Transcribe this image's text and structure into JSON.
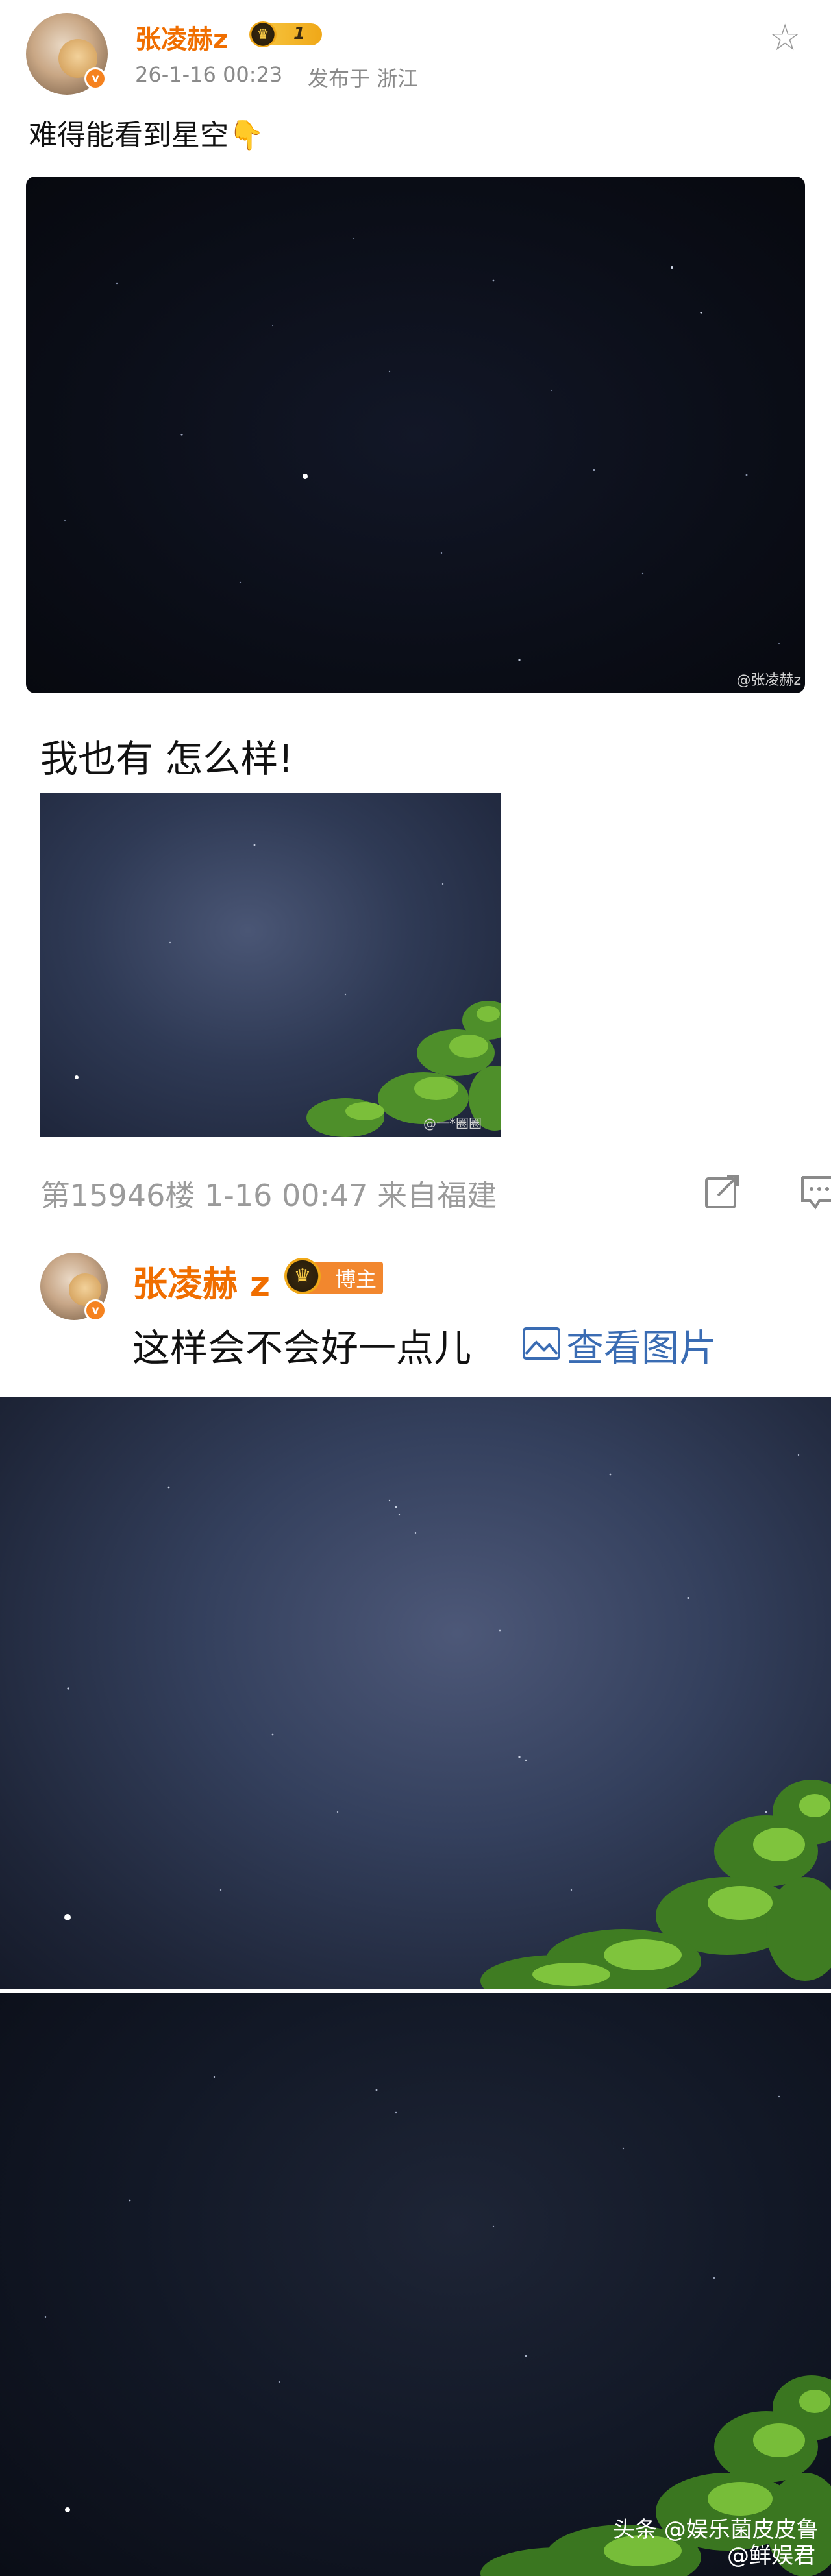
{
  "post": {
    "user_name": "张凌赫z",
    "level": "1",
    "verified_mark": "v",
    "time": "26-1-16 00:23",
    "location": "发布于 浙江",
    "text": "难得能看到星空👇",
    "photo_watermark": "@张凌赫z"
  },
  "comment": {
    "text": "我也有 怎么样!",
    "photo_watermark": "@一*圈圈",
    "floor_meta": "第15946楼 1-16 00:47 来自福建"
  },
  "reply": {
    "user_name": "张凌赫 z",
    "verified_mark": "v",
    "host_badge": "博主",
    "text": "这样会不会好一点儿",
    "view_image": "查看图片"
  },
  "watermark": {
    "toutiao": "头条 @娱乐菌皮皮鲁",
    "weibo": "@鲜娱君"
  },
  "icons": {
    "favorite": "star-icon",
    "share": "share-icon",
    "comment": "comment-icon",
    "image": "image-icon",
    "crown": "crown-icon"
  },
  "colors": {
    "username": "#f06e00",
    "link": "#3a6cb3",
    "meta": "#8a8a8a",
    "verified": "#f5821f",
    "host_badge": "#f2872e"
  }
}
